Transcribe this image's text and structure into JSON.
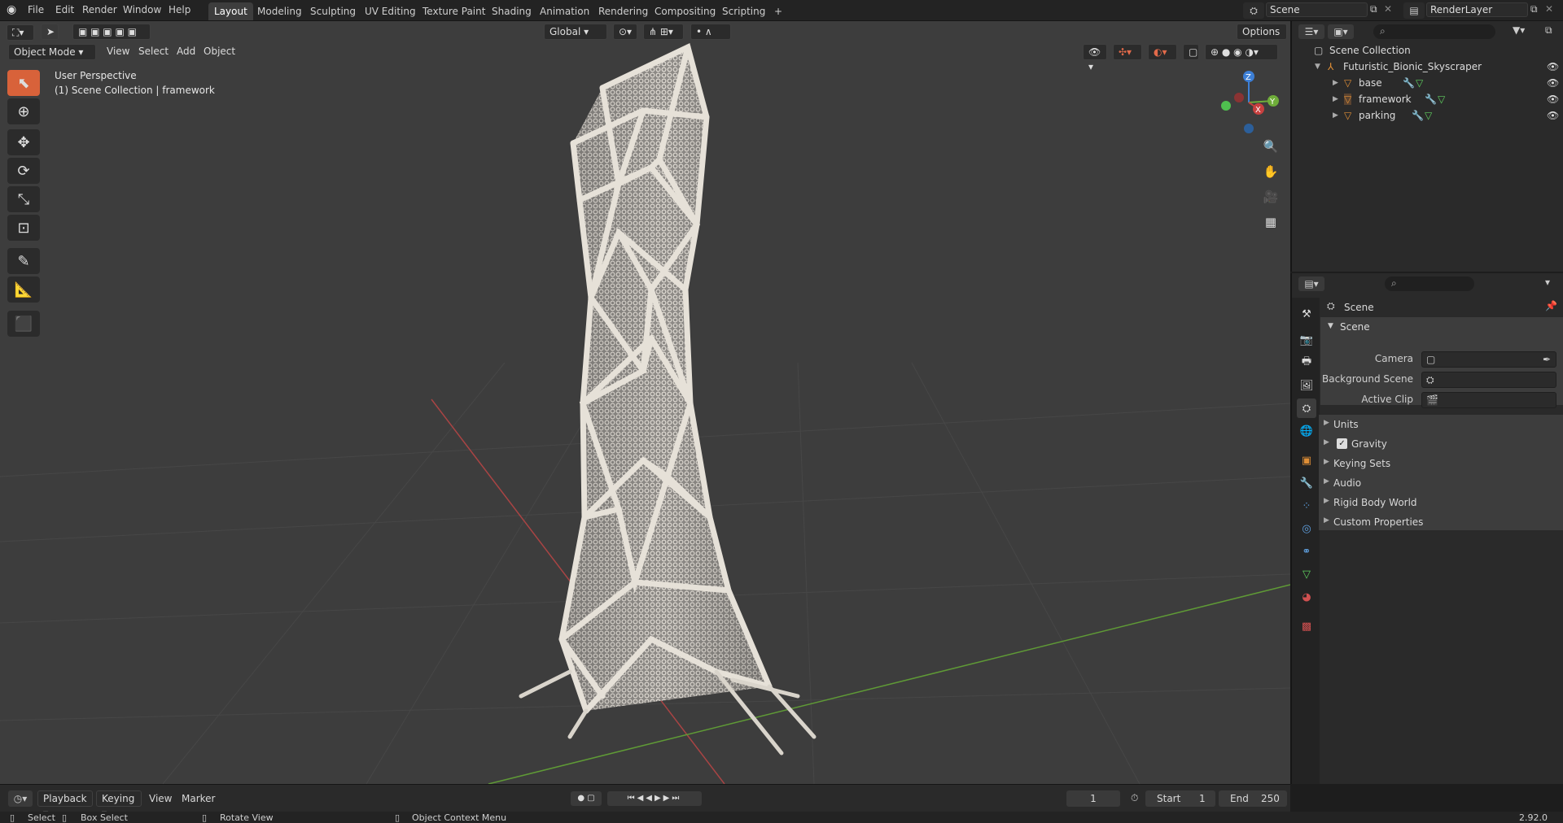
{
  "topbar": {
    "menus": [
      "File",
      "Edit",
      "Render",
      "Window",
      "Help"
    ],
    "workspaces": [
      "Layout",
      "Modeling",
      "Sculpting",
      "UV Editing",
      "Texture Paint",
      "Shading",
      "Animation",
      "Rendering",
      "Compositing",
      "Scripting"
    ],
    "active_workspace": "Layout",
    "add_tab": "+",
    "scene_name": "Scene",
    "render_layer": "RenderLayer"
  },
  "viewport_header": {
    "mode": "Object Mode",
    "menus": [
      "View",
      "Select",
      "Add",
      "Object"
    ],
    "orientation": "Global",
    "options": "Options"
  },
  "viewport": {
    "perspective_label": "User Perspective",
    "collection_label": "(1) Scene Collection | framework",
    "gizmo": {
      "x": "X",
      "y": "Y",
      "z": "Z"
    },
    "colors": {
      "x_axis": "#c8403f",
      "y_axis": "#6fad3a",
      "z_axis": "#3d7fd6",
      "grid": "#474747",
      "model": "#e3ded6"
    }
  },
  "outliner": {
    "root": "Scene Collection",
    "collection": "Futuristic_Bionic_Skyscraper",
    "objects": [
      "base",
      "framework",
      "parking"
    ]
  },
  "properties": {
    "context": "Scene",
    "panel_title": "Scene",
    "fields": [
      {
        "label": "Camera"
      },
      {
        "label": "Background Scene"
      },
      {
        "label": "Active Clip"
      }
    ],
    "subpanels": [
      "Units",
      "Gravity",
      "Keying Sets",
      "Audio",
      "Rigid Body World",
      "Custom Properties"
    ],
    "gravity_checked": true
  },
  "timeline": {
    "menus": [
      "Playback",
      "Keying",
      "View",
      "Marker"
    ],
    "current_frame": "1",
    "start_label": "Start",
    "start": "1",
    "end_label": "End",
    "end": "250"
  },
  "statusbar": {
    "select": "Select",
    "box_select": "Box Select",
    "rotate_view": "Rotate View",
    "context_menu": "Object Context Menu",
    "version": "2.92.0"
  }
}
